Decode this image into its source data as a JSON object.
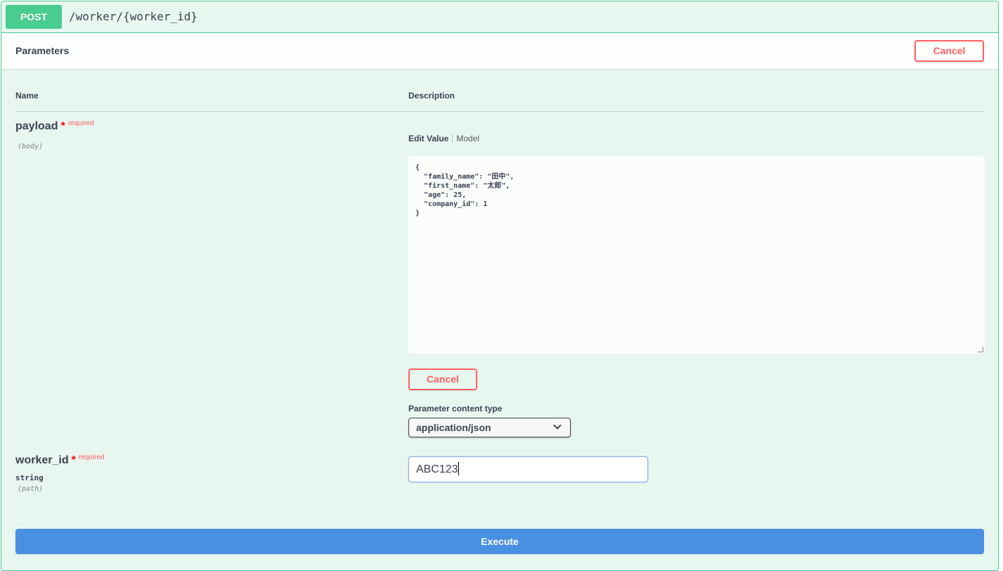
{
  "operation": {
    "method": "POST",
    "path": "/worker/{worker_id}"
  },
  "parameters_section": {
    "title": "Parameters",
    "cancel_label": "Cancel",
    "col_name": "Name",
    "col_description": "Description"
  },
  "params": [
    {
      "name": "payload",
      "required_star": "*",
      "required_label": "required",
      "in": "(body)",
      "tabs": {
        "edit_value": "Edit Value",
        "model": "Model"
      },
      "body_value": "{\n  \"family_name\": \"田中\",\n  \"first_name\": \"太郎\",\n  \"age\": 25,\n  \"company_id\": 1\n}",
      "cancel_label": "Cancel",
      "content_type_label": "Parameter content type",
      "content_type_selected": "application/json"
    },
    {
      "name": "worker_id",
      "required_star": "*",
      "required_label": "required",
      "type": "string",
      "in": "(path)",
      "value": "ABC123"
    }
  ],
  "execute_label": "Execute",
  "colors": {
    "post_green": "#49cc90",
    "block_bg": "#e8f6f0",
    "cancel_red": "#ff6060",
    "execute_blue": "#4990e2"
  }
}
